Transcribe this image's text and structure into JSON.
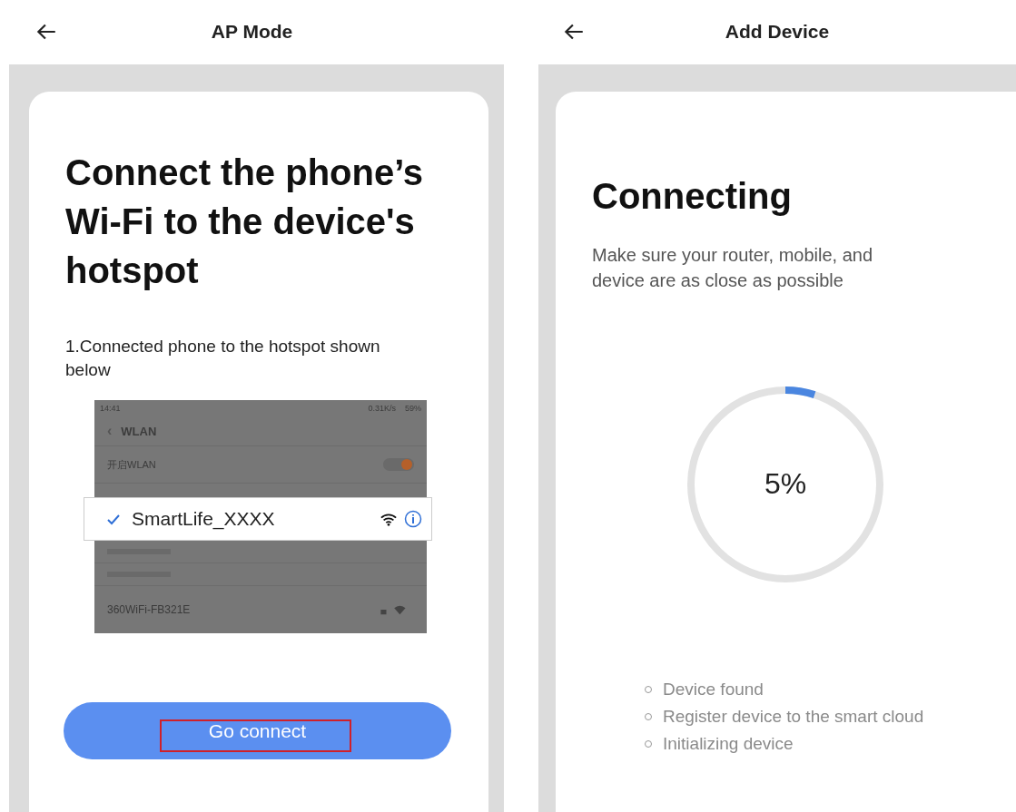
{
  "left_screen": {
    "title": "AP Mode",
    "heading": "Connect the phone’s Wi-Fi to the device's hotspot",
    "step": "1.Connected phone to the hotspot shown below",
    "phone_screenshot": {
      "time": "14:41",
      "network_speed": "0.31K/s",
      "battery": "59%",
      "back_glyph": "‹",
      "page_title": "WLAN",
      "toggle_label": "开启WLAN",
      "wlan_on": true,
      "networks": [
        {
          "name": "SmartLife_XXXX",
          "selected": true
        },
        {
          "name": "360WiFi-FB321E",
          "selected": false
        }
      ]
    },
    "button": "Go connect"
  },
  "right_screen": {
    "title": "Add Device",
    "heading": "Connecting",
    "description": "Make sure your router, mobile, and device are as close as possible",
    "progress": {
      "level": 0.05,
      "reading": "5%"
    },
    "steps": [
      "Device found",
      "Register device to the smart cloud",
      "Initializing device"
    ]
  }
}
